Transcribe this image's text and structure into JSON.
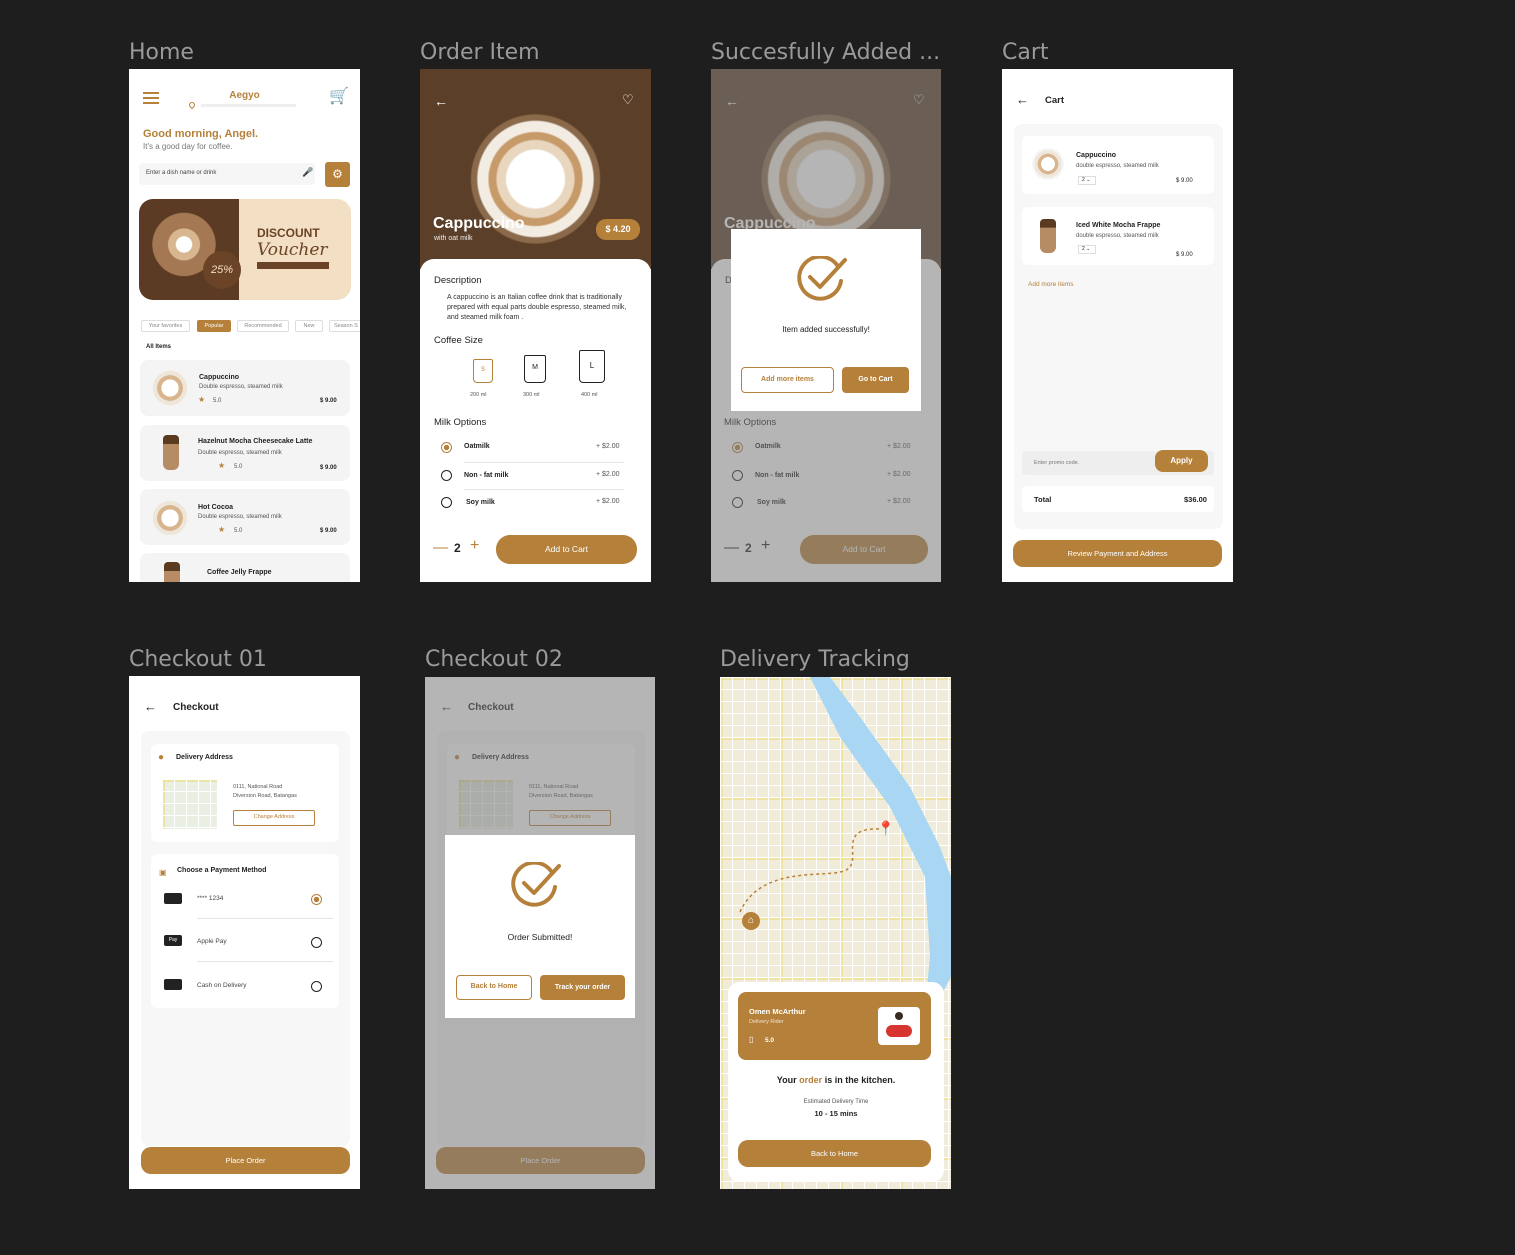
{
  "frames": {
    "home": "Home",
    "order_item": "Order Item",
    "success": "Succesfully Added ...",
    "cart": "Cart",
    "checkout1": "Checkout 01",
    "checkout2": "Checkout 02",
    "tracking": "Delivery Tracking"
  },
  "colors": {
    "accent": "#b5803a",
    "canvas": "#1e1e1e"
  },
  "home": {
    "brand": "Aegyo",
    "greeting": "Good morning, Angel.",
    "subtitle": "It's a good day for coffee.",
    "search_placeholder": "Enter a dish name or drink",
    "voucher_title": "DISCOUNT",
    "voucher_script": "Voucher",
    "voucher_discount": "25%",
    "tabs": [
      "Your favorites",
      "Popular",
      "Recommended",
      "New",
      "Season S"
    ],
    "section": "All Items",
    "items": [
      {
        "name": "Cappuccino",
        "desc": "Double espresso, steamed milk",
        "rating": "5.0",
        "price": "$ 9.00"
      },
      {
        "name": "Hazelnut Mocha Cheesecake Latte",
        "desc": "Double espresso, steamed milk",
        "rating": "5.0",
        "price": "$ 9.00"
      },
      {
        "name": "Hot Cocoa",
        "desc": "Double espresso, steamed milk",
        "rating": "5.0",
        "price": "$ 9.00"
      },
      {
        "name": "Coffee Jelly Frappe"
      }
    ]
  },
  "order": {
    "title": "Cappuccino",
    "subtitle": "with oat milk",
    "price": "$ 4.20",
    "desc_heading": "Description",
    "desc": "A cappuccino is an Italian coffee drink that is traditionally prepared with equal parts double espresso, steamed milk, and steamed milk foam .",
    "size_heading": "Coffee Size",
    "sizes": [
      {
        "code": "S",
        "ml": "200 ml"
      },
      {
        "code": "M",
        "ml": "300 ml"
      },
      {
        "code": "L",
        "ml": "400 ml"
      }
    ],
    "milk_heading": "Milk Options",
    "milks": [
      {
        "name": "Oatmilk",
        "price": "+ $2.00"
      },
      {
        "name": "Non - fat milk",
        "price": "+ $2.00"
      },
      {
        "name": "Soy milk",
        "price": "+ $2.00"
      }
    ],
    "qty": "2",
    "add": "Add to Cart"
  },
  "success": {
    "message": "Item added successfully!",
    "more": "Add more items",
    "go": "Go to Cart"
  },
  "cart": {
    "title": "Cart",
    "items": [
      {
        "name": "Cappuccino",
        "desc": "double espresso, steamed milk",
        "qty": "2",
        "price": "$ 9.00"
      },
      {
        "name": "Iced White Mocha Frappe",
        "desc": "double espresso, steamed milk",
        "qty": "2",
        "price": "$ 9.00"
      }
    ],
    "add_more": "Add more items",
    "promo_placeholder": "Enter promo code.",
    "apply": "Apply",
    "total_label": "Total",
    "total": "$36.00",
    "review": "Review Payment and Address"
  },
  "checkout": {
    "title": "Checkout",
    "addr_heading": "Delivery Address",
    "addr1": "0111, National Road",
    "addr2": "Diversion Road, Batangas",
    "change": "Change Address",
    "pay_heading": "Choose a Payment Method",
    "methods": [
      {
        "name": "**** 1234"
      },
      {
        "name": "Apple Pay"
      },
      {
        "name": "Cash on Delivery"
      }
    ],
    "place": "Place Order"
  },
  "submitted": {
    "message": "Order Submitted!",
    "home": "Back to Home",
    "track": "Track your order"
  },
  "tracking": {
    "rider": "Omen McArthur",
    "role": "Delivery Rider",
    "rating": "5.0",
    "status_pre": "Your",
    "status_word": "order",
    "status_post": "is in the kitchen.",
    "eta_label": "Estimated Delivery Time",
    "eta": "10 - 15 mins",
    "home": "Back to Home"
  }
}
